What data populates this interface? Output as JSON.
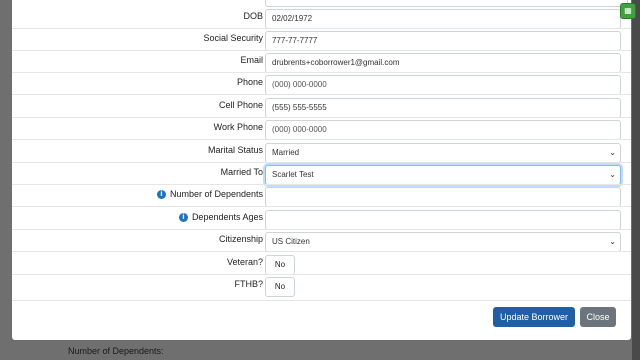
{
  "backdrop": {
    "label": "Number of Dependents:"
  },
  "form": {
    "dob": {
      "label": "DOB",
      "value": "02/02/1972"
    },
    "social_security": {
      "label": "Social Security",
      "value": "777-77-7777"
    },
    "email": {
      "label": "Email",
      "value": "drubrents+coborrower1@gmail.com"
    },
    "phone": {
      "label": "Phone",
      "placeholder": "(000) 000-0000"
    },
    "cell_phone": {
      "label": "Cell Phone",
      "value": "(555) 555-5555"
    },
    "work_phone": {
      "label": "Work Phone",
      "placeholder": "(000) 000-0000"
    },
    "marital_status": {
      "label": "Marital Status",
      "value": "Married"
    },
    "married_to": {
      "label": "Married To",
      "value": "Scarlet Test"
    },
    "number_of_dependents": {
      "label": "Number of Dependents",
      "value": ""
    },
    "dependents_ages": {
      "label": "Dependents Ages",
      "value": ""
    },
    "citizenship": {
      "label": "Citizenship",
      "value": "US Citizen"
    },
    "veteran": {
      "label": "Veteran?",
      "value": "No"
    },
    "fthb": {
      "label": "FTHB?",
      "value": "No"
    }
  },
  "footer": {
    "update_label": "Update Borrower",
    "close_label": "Close"
  },
  "icons": {
    "info": "info-circle-icon",
    "chevron": "chevron-down-icon",
    "badge": "grid-badge-icon"
  },
  "colors": {
    "primary": "#1f5fa8",
    "secondary": "#6c757d",
    "info": "#1a73c9",
    "focus": "#80bdff"
  }
}
